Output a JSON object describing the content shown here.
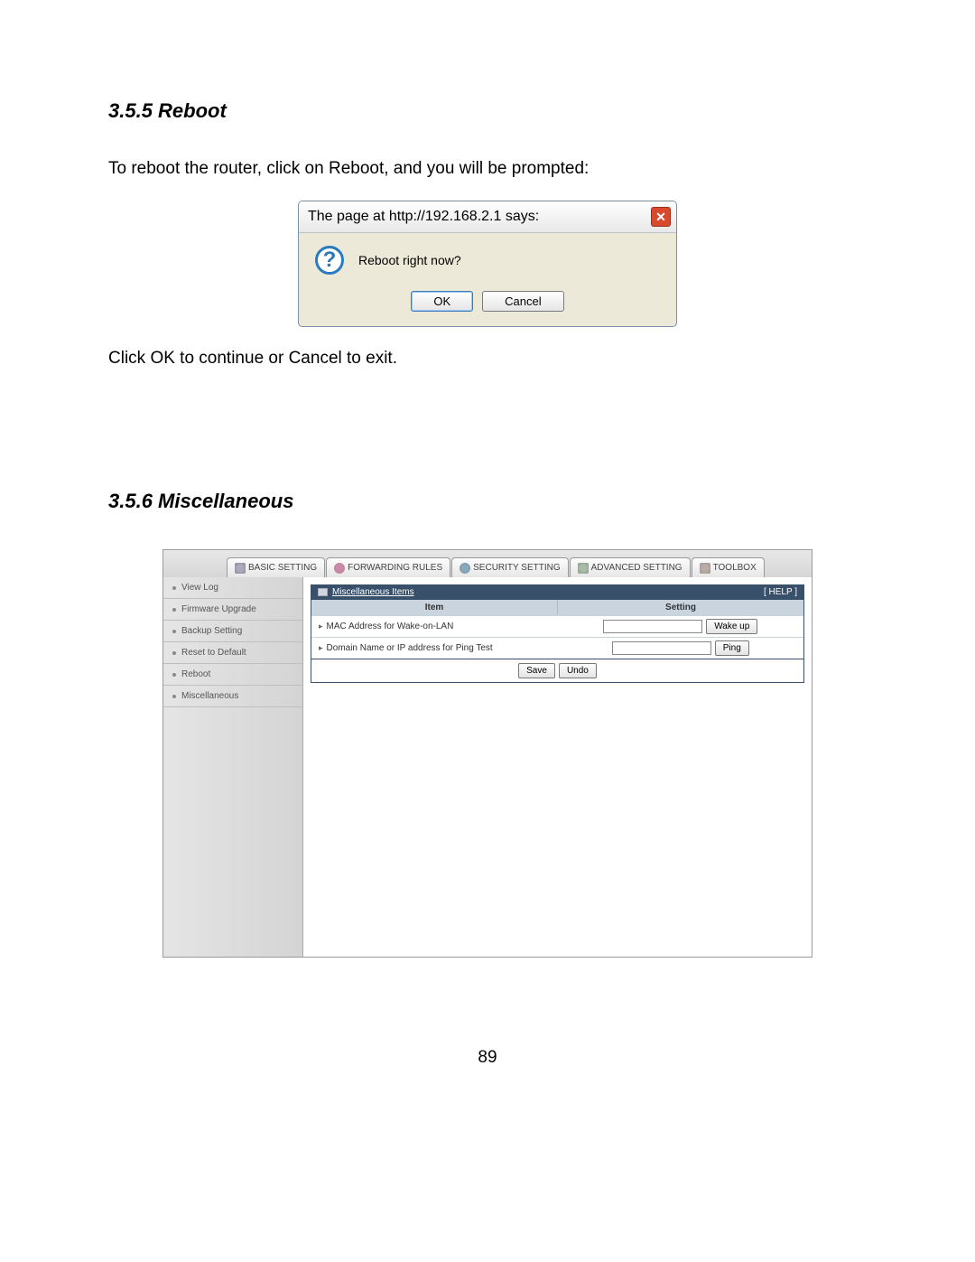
{
  "section1": {
    "heading": "3.5.5 Reboot",
    "intro": "To reboot the router, click on Reboot, and you will be prompted:",
    "outro": "Click OK to continue or Cancel to exit."
  },
  "dialog": {
    "title": "The page at http://192.168.2.1 says:",
    "message": "Reboot right now?",
    "ok_label": "OK",
    "cancel_label": "Cancel"
  },
  "section2": {
    "heading": "3.5.6 Miscellaneous"
  },
  "admin": {
    "tabs": {
      "basic": "BASIC SETTING",
      "forwarding": "FORWARDING RULES",
      "security": "SECURITY SETTING",
      "advanced": "ADVANCED SETTING",
      "toolbox": "TOOLBOX"
    },
    "sidebar": {
      "view_log": "View Log",
      "firmware": "Firmware Upgrade",
      "backup": "Backup Setting",
      "reset": "Reset to Default",
      "reboot": "Reboot",
      "misc": "Miscellaneous"
    },
    "panel": {
      "title": "Miscellaneous Items",
      "help": "[ HELP ]",
      "th_item": "Item",
      "th_setting": "Setting",
      "row1_label": "MAC Address for Wake-on-LAN",
      "row1_btn": "Wake up",
      "row2_label": "Domain Name or IP address for Ping Test",
      "row2_btn": "Ping",
      "save_label": "Save",
      "undo_label": "Undo"
    }
  },
  "page_number": "89"
}
